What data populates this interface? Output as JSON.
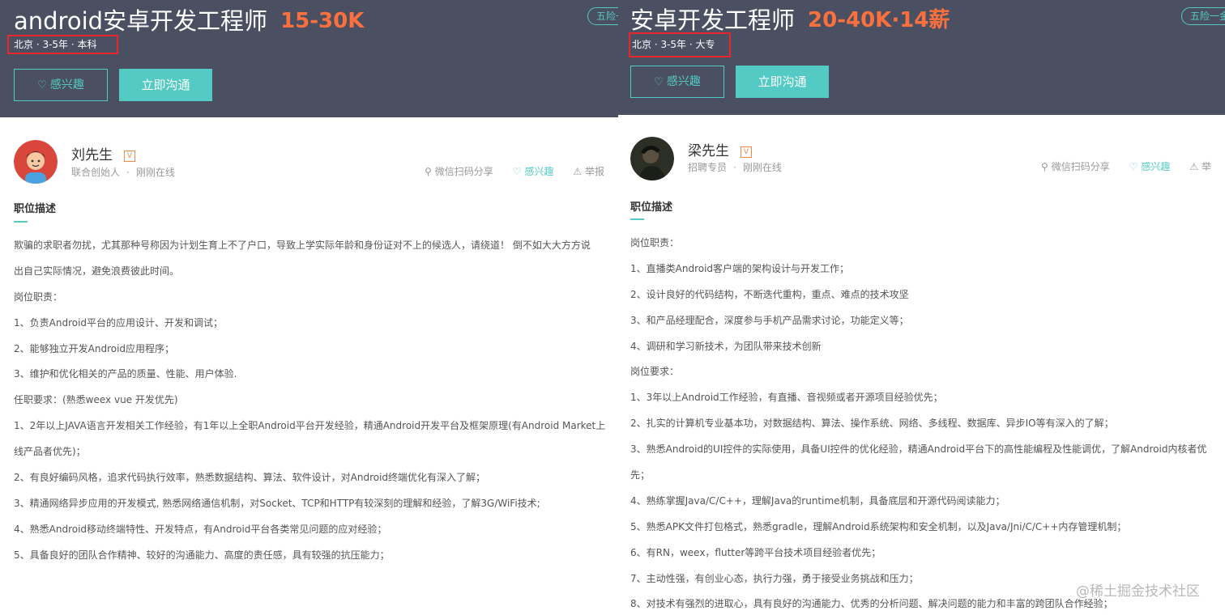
{
  "left": {
    "title": "android安卓开发工程师",
    "salary": "15-30K",
    "tag": "五险一",
    "meta": "北京 · 3-5年 · 本科",
    "btn_interest": "感兴趣",
    "btn_chat": "立即沟通",
    "recruiter_name": "刘先生",
    "recruiter_role": "联合创始人",
    "recruiter_status": "刚刚在线",
    "share": "微信扫码分享",
    "interest": "感兴趣",
    "report": "举报",
    "section_title": "职位描述",
    "lines": [
      "欺骗的求职者勿扰，尤其那种号称因为计划生育上不了户口，导致上学实际年龄和身份证对不上的候选人，请绕道！ 倒不如大大方方说",
      "出自己实际情况，避免浪费彼此时间。",
      "岗位职责：",
      "1、负责Android平台的应用设计、开发和调试；",
      "2、能够独立开发Android应用程序；",
      "3、维护和优化相关的产品的质量、性能、用户体验.",
      "任职要求：(熟悉weex vue 开发优先)",
      "1、2年以上JAVA语言开发相关工作经验，有1年以上全职Android平台开发经验，精通Android开发平台及框架原理(有Android Market上",
      "线产品者优先)；",
      "2、有良好编码风格，追求代码执行效率，熟悉数据结构、算法、软件设计，对Android终端优化有深入了解；",
      "3、精通网络异步应用的开发模式, 熟悉网络通信机制，对Socket、TCP和HTTP有较深刻的理解和经验，了解3G/WiFi技术;",
      "4、熟悉Android移动终端特性、开发特点，有Android平台各类常见问题的应对经验；",
      "5、具备良好的团队合作精神、较好的沟通能力、高度的责任感，具有较强的抗压能力；"
    ]
  },
  "right": {
    "title": "安卓开发工程师",
    "salary": "20-40K·14薪",
    "tag": "五险一金",
    "meta": "北京 · 3-5年 · 大专",
    "btn_interest": "感兴趣",
    "btn_chat": "立即沟通",
    "recruiter_name": "梁先生",
    "recruiter_role": "招聘专员",
    "recruiter_status": "刚刚在线",
    "share": "微信扫码分享",
    "interest": "感兴趣",
    "report": "举",
    "section_title": "职位描述",
    "lines": [
      "岗位职责：",
      "1、直播类Android客户端的架构设计与开发工作；",
      "2、设计良好的代码结构，不断迭代重构，重点、难点的技术攻坚",
      "3、和产品经理配合，深度参与手机产品需求讨论，功能定义等；",
      "4、调研和学习新技术，为团队带来技术创新",
      "岗位要求：",
      "1、3年以上Android工作经验，有直播、音视频或者开源项目经验优先；",
      "2、扎实的计算机专业基本功，对数据结构、算法、操作系统、网络、多线程、数据库、异步IO等有深入的了解；",
      "3、熟悉Android的UI控件的实际使用，具备UI控件的优化经验，精通Android平台下的高性能编程及性能调优，了解Android内核者优",
      "先；",
      "4、熟练掌握Java/C/C++，理解Java的runtime机制，具备底层和开源代码阅读能力；",
      "5、熟悉APK文件打包格式，熟悉gradle，理解Android系统架构和安全机制，以及Java/Jni/C/C++内存管理机制；",
      "6、有RN，weex，flutter等跨平台技术项目经验者优先；",
      "7、主动性强，有创业心态，执行力强，勇于接受业务挑战和压力；",
      "8、对技术有强烈的进取心，具有良好的沟通能力、优秀的分析问题、解决问题的能力和丰富的跨团队合作经验；"
    ]
  },
  "watermark": "@稀土掘金技术社区",
  "colors": {
    "header_bg": "#4a4f62",
    "accent": "#53cac3",
    "salary": "#fc703e",
    "highlight_box": "#e8262b"
  },
  "icons": [
    "heart-icon",
    "verified-badge-icon",
    "link-icon",
    "warning-icon"
  ]
}
